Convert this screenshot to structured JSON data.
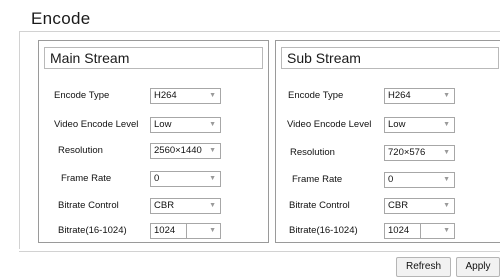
{
  "page": {
    "title": "Encode"
  },
  "main_stream": {
    "title": "Main Stream",
    "rows": [
      {
        "label": "Encode Type",
        "value": "H264"
      },
      {
        "label": "Video Encode Level",
        "value": "Low"
      },
      {
        "label": "Resolution",
        "value": "2560×1440"
      },
      {
        "label": "Frame Rate",
        "value": "0"
      },
      {
        "label": "Bitrate Control",
        "value": "CBR"
      },
      {
        "label": "Bitrate(16-1024)",
        "value": "1024"
      }
    ]
  },
  "sub_stream": {
    "title": "Sub Stream",
    "rows": [
      {
        "label": "Encode Type",
        "value": "H264"
      },
      {
        "label": "Video Encode Level",
        "value": "Low"
      },
      {
        "label": "Resolution",
        "value": "720×576"
      },
      {
        "label": "Frame Rate",
        "value": "0"
      },
      {
        "label": "Bitrate Control",
        "value": "CBR"
      },
      {
        "label": "Bitrate(16-1024)",
        "value": "1024"
      }
    ]
  },
  "footer": {
    "refresh_label": "Refresh",
    "apply_label": "Apply"
  },
  "icons": {
    "dropdown": "chevron-down-icon"
  }
}
